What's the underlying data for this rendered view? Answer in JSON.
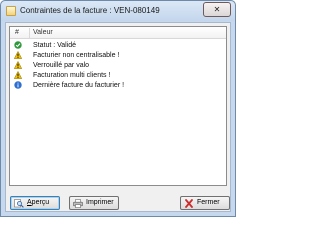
{
  "window": {
    "title": "Contraintes de la facture : VEN-080149",
    "close_glyph": "✕"
  },
  "list": {
    "columns": [
      "#",
      "Valeur"
    ],
    "rows": [
      {
        "icon": "check-icon",
        "text": "Statut : Validé"
      },
      {
        "icon": "warning-icon",
        "text": "Facturier non centralisable !"
      },
      {
        "icon": "warning-icon",
        "text": "Verrouillé par valo"
      },
      {
        "icon": "warning-icon",
        "text": "Facturation multi clients !"
      },
      {
        "icon": "info-icon",
        "text": "Dernière facture du facturier !"
      }
    ]
  },
  "buttons": {
    "apercu_first": "A",
    "apercu_rest": "perçu",
    "imprimer": "Imprimer",
    "fermer": "Fermer"
  },
  "colors": {
    "check": "#2e9a3a",
    "warning": "#f2c200",
    "info": "#2f6fcf"
  }
}
